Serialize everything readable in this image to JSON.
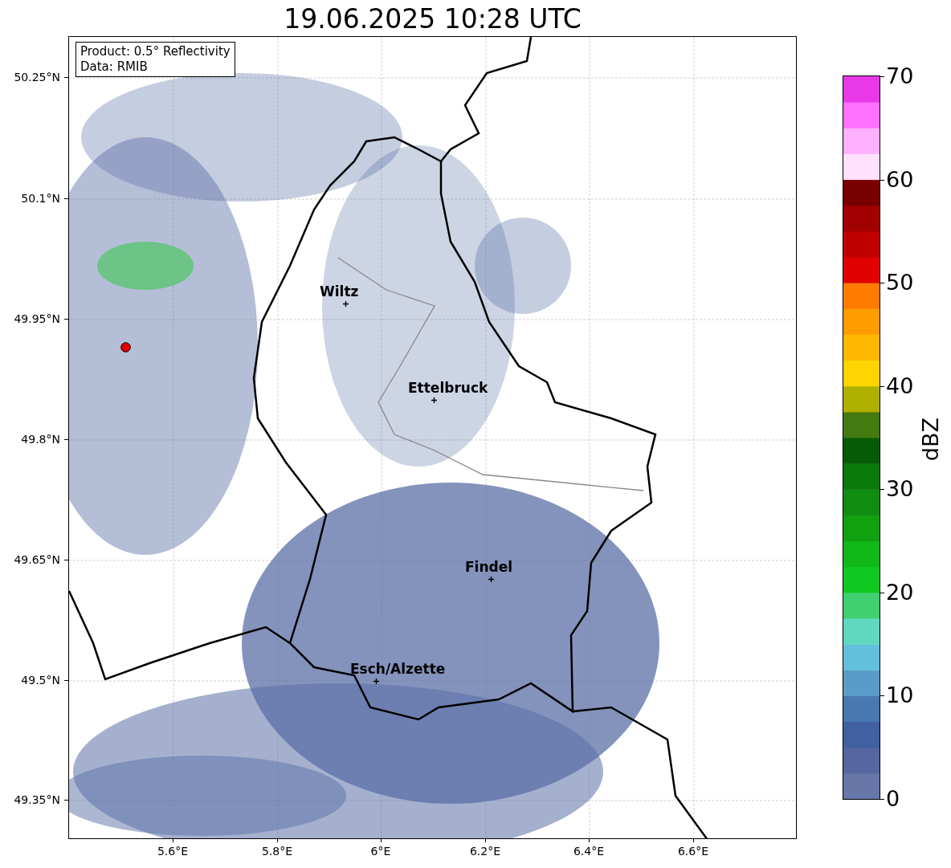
{
  "title": "19.06.2025 10:28 UTC",
  "map": {
    "info_box": [
      "Product: 0.5° Reflectivity",
      "Data: RMIB"
    ],
    "lat_ticks": [
      "50.25°N",
      "50.1°N",
      "49.95°N",
      "49.8°N",
      "49.65°N",
      "49.5°N",
      "49.35°N"
    ],
    "lon_ticks": [
      "5.6°E",
      "5.8°E",
      "6°E",
      "6.2°E",
      "6.4°E",
      "6.6°E"
    ],
    "cities": [
      {
        "name": "Wiltz"
      },
      {
        "name": "Ettelbruck"
      },
      {
        "name": "Findel"
      },
      {
        "name": "Esch/Alzette"
      }
    ]
  },
  "colorbar": {
    "label": "dBZ",
    "ticks": [
      "70",
      "60",
      "50",
      "40",
      "30",
      "20",
      "10",
      "0"
    ],
    "bins": [
      {
        "color": "#6677a8"
      },
      {
        "color": "#5566a0"
      },
      {
        "color": "#4060a0"
      },
      {
        "color": "#4a78b0"
      },
      {
        "color": "#5a9cc8"
      },
      {
        "color": "#63c0dc"
      },
      {
        "color": "#60d8c0"
      },
      {
        "color": "#40d070"
      },
      {
        "color": "#10c820"
      },
      {
        "color": "#10b818"
      },
      {
        "color": "#10a010"
      },
      {
        "color": "#108c10"
      },
      {
        "color": "#0a7a0a"
      },
      {
        "color": "#065c06"
      },
      {
        "color": "#457a10"
      },
      {
        "color": "#b0b000"
      },
      {
        "color": "#ffd400"
      },
      {
        "color": "#ffb800"
      },
      {
        "color": "#ff9c00"
      },
      {
        "color": "#ff7c00"
      },
      {
        "color": "#e00000"
      },
      {
        "color": "#c00000"
      },
      {
        "color": "#a00000"
      },
      {
        "color": "#780000"
      },
      {
        "color": "#ffe0ff"
      },
      {
        "color": "#ffb0ff"
      },
      {
        "color": "#ff70ff"
      },
      {
        "color": "#e838e8"
      }
    ]
  }
}
